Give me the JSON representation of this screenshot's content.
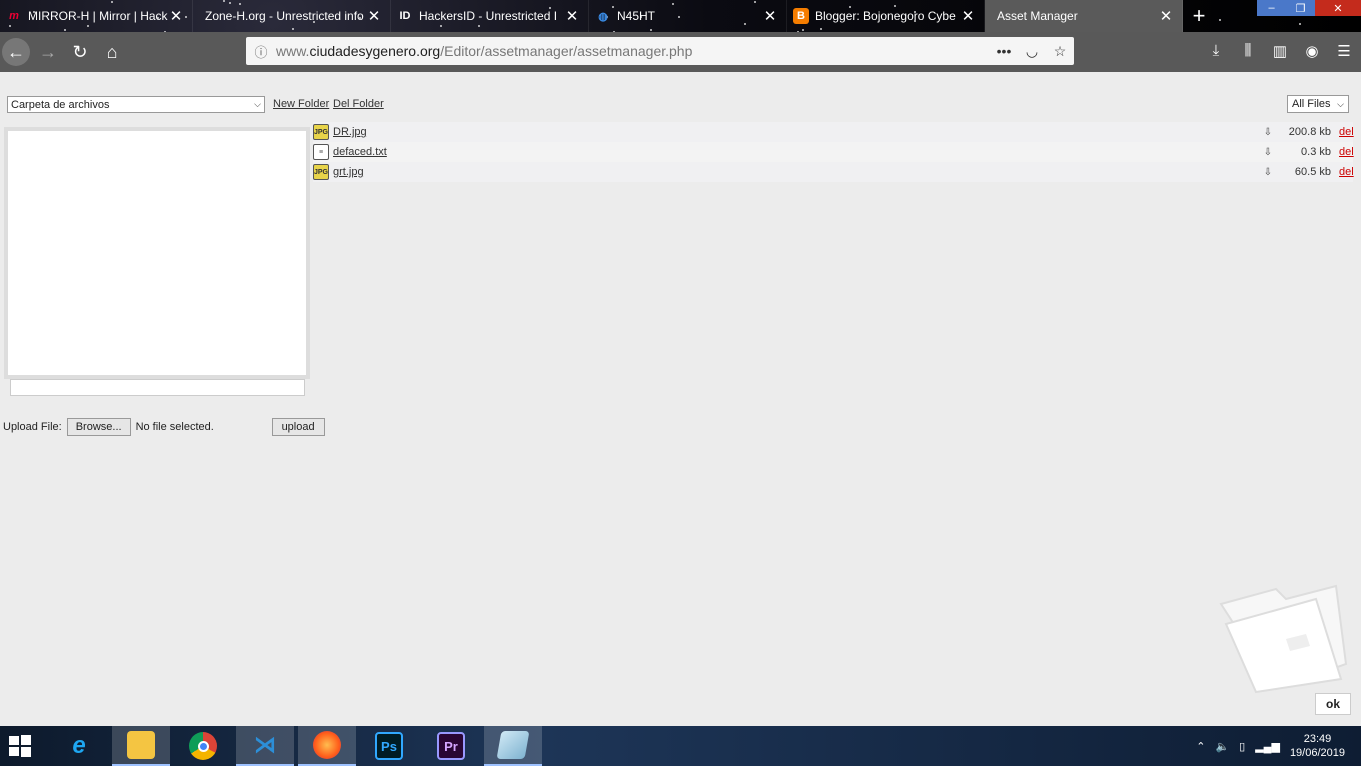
{
  "browser": {
    "tabs": [
      {
        "title": "MIRROR-H | Mirror | Hack",
        "icon": "mirror-h-icon"
      },
      {
        "title": "Zone-H.org - Unrestricted info",
        "icon": "zone-h-icon"
      },
      {
        "title": "HackersID - Unrestricted I",
        "icon": "hackersid-icon"
      },
      {
        "title": "N45HT",
        "icon": "globe-icon"
      },
      {
        "title": "Blogger: Bojonegoro Cybe",
        "icon": "blogger-icon"
      },
      {
        "title": "Asset Manager",
        "icon": "none"
      }
    ],
    "url_prefix": "www.",
    "url_host": "ciudadesygenero.org",
    "url_path": "/Editor/assetmanager/assetmanager.php"
  },
  "asset_manager": {
    "folder_select": "Carpeta de archivos",
    "new_folder": "New Folder",
    "del_folder": "Del Folder",
    "filter": "All Files",
    "files": [
      {
        "name": "DR.jpg",
        "type": "img",
        "size": "200.8 kb",
        "del": "del"
      },
      {
        "name": "defaced.txt",
        "type": "txt",
        "size": "0.3 kb",
        "del": "del"
      },
      {
        "name": "grt.jpg",
        "type": "img",
        "size": "60.5 kb",
        "del": "del"
      }
    ],
    "upload_label": "Upload File:",
    "browse": "Browse...",
    "no_file": "No file selected.",
    "upload_btn": "upload",
    "ok": "ok"
  },
  "taskbar": {
    "time": "23:49",
    "date": "19/06/2019",
    "apps": [
      "internet-explorer-icon",
      "file-explorer-icon",
      "chrome-icon",
      "vscode-icon",
      "firefox-icon",
      "photoshop-icon",
      "premiere-icon",
      "notepad-icon"
    ]
  }
}
